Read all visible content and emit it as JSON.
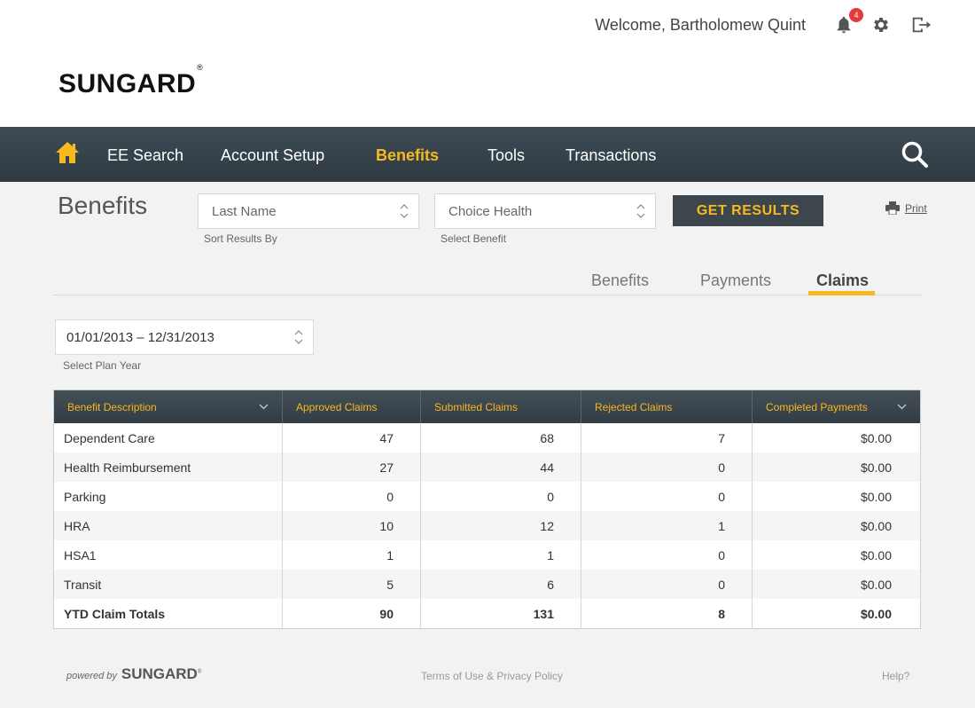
{
  "header": {
    "welcome": "Welcome, Bartholomew Quint",
    "notification_count": "4",
    "logo": "SUNGARD",
    "logo_mark": "®"
  },
  "nav": {
    "items": [
      {
        "label": "EE Search"
      },
      {
        "label": "Account Setup"
      },
      {
        "label": "Benefits"
      },
      {
        "label": "Tools"
      },
      {
        "label": "Transactions"
      }
    ],
    "active": "Benefits"
  },
  "page": {
    "title": "Benefits",
    "sort_select": {
      "value": "Last Name",
      "label": "Sort Results By"
    },
    "benefit_select": {
      "value": "Choice Health",
      "label": "Select Benefit"
    },
    "get_results": "GET RESULTS",
    "print": "Print"
  },
  "tabs": [
    {
      "label": "Benefits"
    },
    {
      "label": "Payments"
    },
    {
      "label": "Claims"
    }
  ],
  "active_tab": "Claims",
  "plan_year": {
    "value": "01/01/2013 – 12/31/2013",
    "label": "Select Plan Year"
  },
  "table": {
    "columns": [
      "Benefit Description",
      "Approved Claims",
      "Submitted Claims",
      "Rejected Claims",
      "Completed Payments"
    ],
    "rows": [
      [
        "Dependent Care",
        "47",
        "68",
        "7",
        "$0.00"
      ],
      [
        "Health Reimbursement",
        "27",
        "44",
        "0",
        "$0.00"
      ],
      [
        "Parking",
        "0",
        "0",
        "0",
        "$0.00"
      ],
      [
        "HRA",
        "10",
        "12",
        "1",
        "$0.00"
      ],
      [
        "HSA1",
        "1",
        "1",
        "0",
        "$0.00"
      ],
      [
        "Transit",
        "5",
        "6",
        "0",
        "$0.00"
      ]
    ],
    "total": [
      "YTD Claim Totals",
      "90",
      "131",
      "8",
      "$0.00"
    ]
  },
  "footer": {
    "powered_by": "powered by",
    "logo": "SUNGARD",
    "terms": "Terms of Use & Privacy Policy",
    "help": "Help?"
  },
  "colors": {
    "accent": "#f6b920",
    "nav_bg": "#38444c",
    "badge": "#e5393b"
  }
}
